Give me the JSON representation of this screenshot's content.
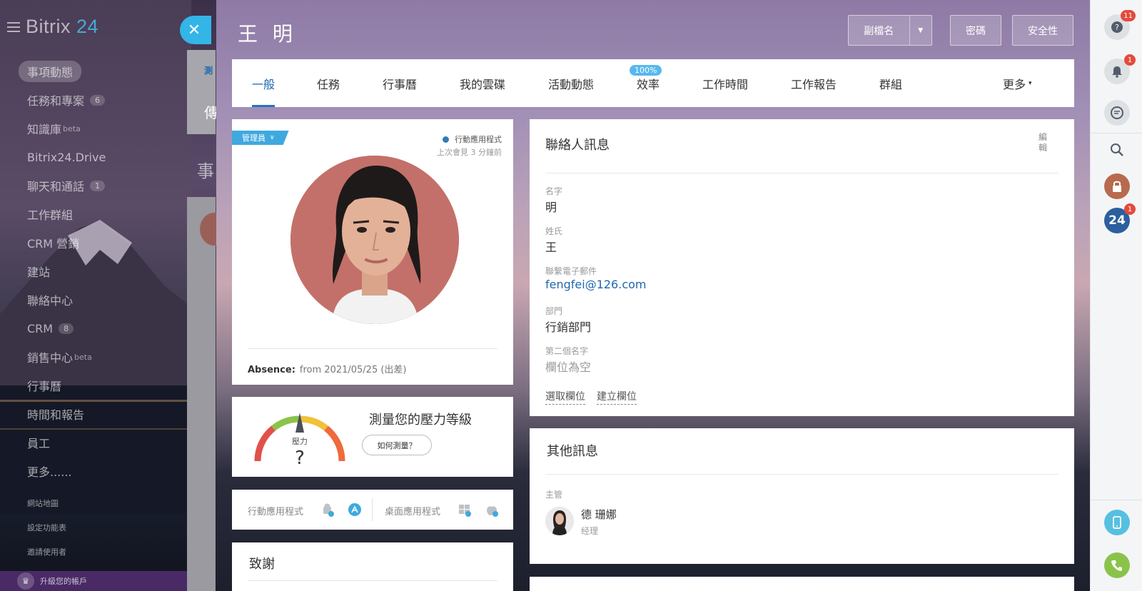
{
  "app": {
    "brand_name": "Bitrix",
    "brand_number": "24"
  },
  "sidebar": {
    "items": [
      {
        "label": "事項動態",
        "active": true
      },
      {
        "label": "任務和專案",
        "badge": "6"
      },
      {
        "label": "知識庫",
        "sup": "beta"
      },
      {
        "label": "Bitrix24.Drive"
      },
      {
        "label": "聊天和通話",
        "badge": "1"
      },
      {
        "label": "工作群組"
      },
      {
        "label": "CRM 營銷"
      },
      {
        "label": "建站"
      },
      {
        "label": "聯絡中心"
      },
      {
        "label": "CRM",
        "badge": "8"
      },
      {
        "label": "銷售中心",
        "sup": "beta"
      },
      {
        "label": "行事曆"
      },
      {
        "label": "時間和報告"
      },
      {
        "label": "員工"
      },
      {
        "label": "更多......"
      }
    ],
    "small_links": [
      "網站地圖",
      "設定功能表",
      "邀請使用者"
    ],
    "upgrade_label": "升級您的帳戶"
  },
  "background_page": {
    "tab_fragment": "測",
    "text_fragment_1": "傳",
    "heading_fragment": "事"
  },
  "header": {
    "title": "王 明",
    "buttons": {
      "alias": "副檔名",
      "password": "密碼",
      "security": "安全性"
    }
  },
  "tabs": [
    {
      "label": "一般",
      "active": true
    },
    {
      "label": "任務"
    },
    {
      "label": "行事曆"
    },
    {
      "label": "我的雲碟"
    },
    {
      "label": "活動動態"
    },
    {
      "label": "效率",
      "badge": "100%"
    },
    {
      "label": "工作時間"
    },
    {
      "label": "工作報告"
    },
    {
      "label": "群組"
    },
    {
      "label": "更多"
    }
  ],
  "profile": {
    "role": "管理員",
    "mobile_app": "行動應用程式",
    "last_seen": "上次會見 3 分鐘前",
    "absence_label": "Absence:",
    "absence_value": "from 2021/05/25 (出差)"
  },
  "stress": {
    "title": "測量您的壓力等級",
    "gauge_label": "壓力",
    "gauge_value": "?",
    "button": "如何測量？"
  },
  "apps": {
    "mobile_label": "行動應用程式",
    "desktop_label": "桌面應用程式"
  },
  "thanks": {
    "title": "致謝"
  },
  "contact": {
    "title": "聯絡人訊息",
    "edit": "編輯",
    "fields": [
      {
        "label": "名字",
        "value": "明"
      },
      {
        "label": "姓氏",
        "value": "王"
      },
      {
        "label": "聯繫電子郵件",
        "value": "fengfei@126.com"
      },
      {
        "label": "部門",
        "value": "行銷部門"
      },
      {
        "label": "第二個名字",
        "value": "欄位為空"
      }
    ],
    "actions": {
      "select": "選取欄位",
      "create": "建立欄位"
    }
  },
  "other": {
    "title": "其他訊息",
    "manager_label": "主管",
    "manager_name": "德 珊娜",
    "manager_position": "经理"
  },
  "rail": {
    "help_badge": "11",
    "notify_badge": "1",
    "b24_badge": "1",
    "b24_text": "24"
  },
  "colors": {
    "accent": "#2a72c0",
    "close_button": "#33b5e8",
    "badge_red": "#e34b3c",
    "role_ribbon": "#3fa9df"
  }
}
